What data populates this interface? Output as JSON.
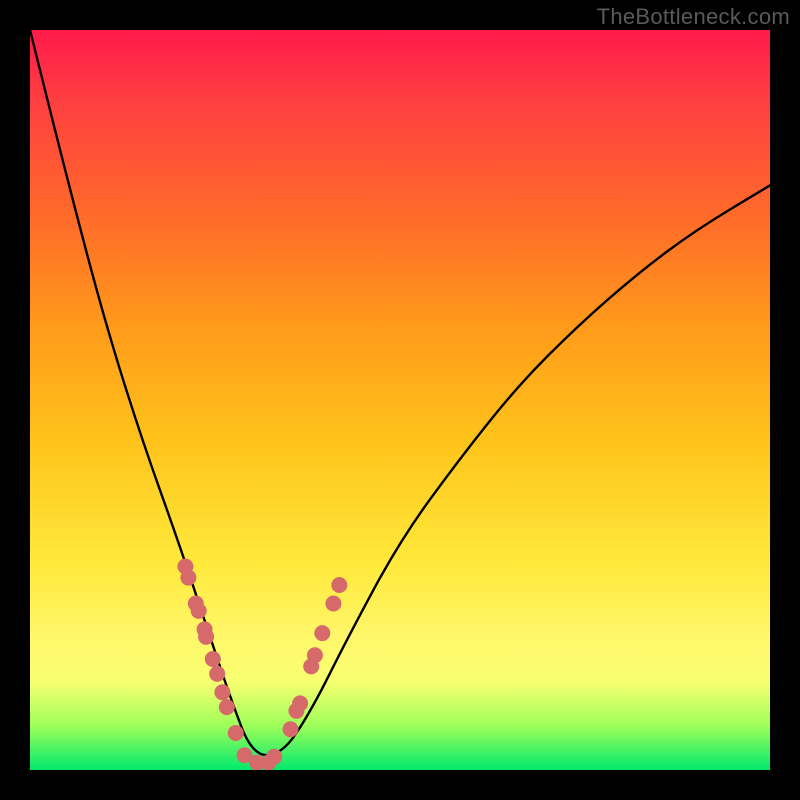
{
  "watermark": "TheBottleneck.com",
  "chart_data": {
    "type": "line",
    "title": "",
    "xlabel": "",
    "ylabel": "",
    "xlim": [
      0,
      1
    ],
    "ylim": [
      0,
      1
    ],
    "x": [
      0.0,
      0.05,
      0.1,
      0.15,
      0.2,
      0.24,
      0.27,
      0.3,
      0.34,
      0.38,
      0.43,
      0.5,
      0.58,
      0.66,
      0.74,
      0.82,
      0.9,
      1.0
    ],
    "y": [
      1.0,
      0.8,
      0.61,
      0.45,
      0.31,
      0.19,
      0.1,
      0.02,
      0.02,
      0.08,
      0.18,
      0.31,
      0.42,
      0.52,
      0.6,
      0.67,
      0.73,
      0.79
    ],
    "marker_series": {
      "name": "data-points",
      "x": [
        0.21,
        0.214,
        0.224,
        0.228,
        0.236,
        0.238,
        0.247,
        0.253,
        0.26,
        0.266,
        0.278,
        0.29,
        0.307,
        0.322,
        0.33,
        0.352,
        0.36,
        0.365,
        0.38,
        0.385,
        0.395,
        0.41,
        0.418
      ],
      "y": [
        0.275,
        0.26,
        0.225,
        0.215,
        0.19,
        0.18,
        0.15,
        0.13,
        0.105,
        0.085,
        0.05,
        0.02,
        0.01,
        0.01,
        0.018,
        0.055,
        0.08,
        0.09,
        0.14,
        0.155,
        0.185,
        0.225,
        0.25
      ],
      "color": "#d66a6a",
      "radius_px": 8
    }
  }
}
